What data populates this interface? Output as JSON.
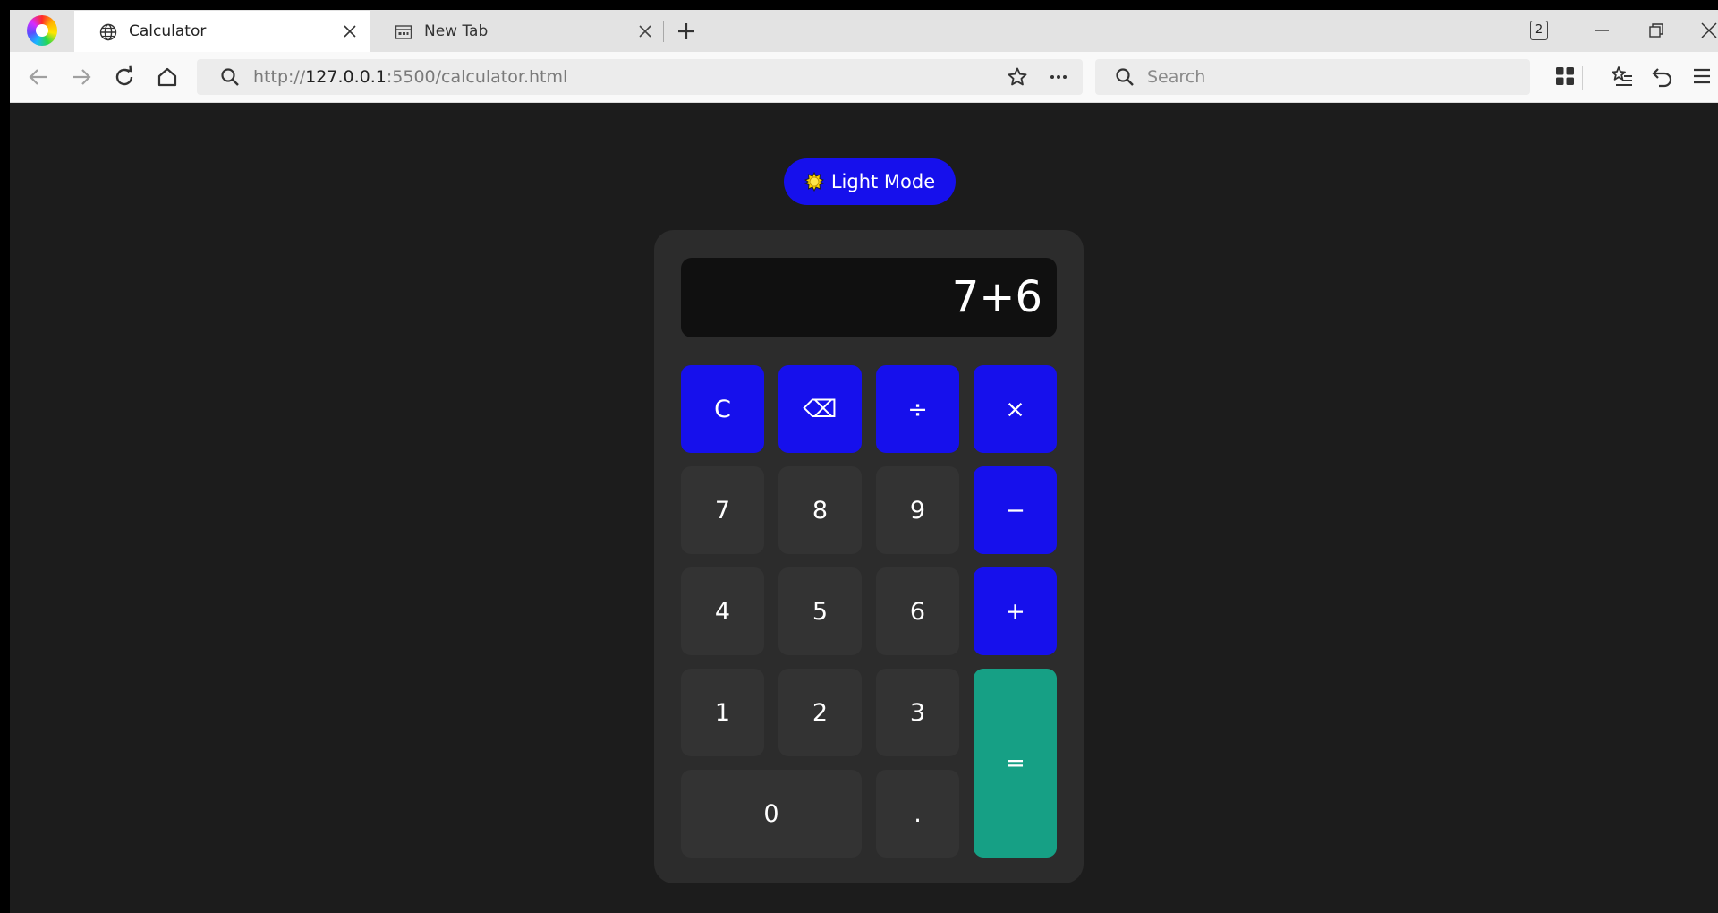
{
  "browser": {
    "tabs": [
      {
        "title": "Calculator",
        "icon": "globe-icon",
        "active": true
      },
      {
        "title": "New Tab",
        "icon": "newtab-page-icon",
        "active": false
      }
    ],
    "tab_count": "2",
    "url": {
      "protocol": "http://",
      "host": "127.0.0.1",
      "rest": ":5500/calculator.html"
    },
    "search_placeholder": "Search"
  },
  "page": {
    "theme_toggle": {
      "icon": "sun-icon",
      "label": "Light Mode"
    },
    "display": "7+6",
    "keys": {
      "clear": "C",
      "backspace": "⌫",
      "divide": "÷",
      "multiply": "×",
      "seven": "7",
      "eight": "8",
      "nine": "9",
      "subtract": "−",
      "four": "4",
      "five": "5",
      "six": "6",
      "add": "+",
      "one": "1",
      "two": "2",
      "three": "3",
      "equals": "=",
      "zero": "0",
      "decimal": "."
    },
    "colors": {
      "background": "#1c1c1c",
      "calculator_body": "#2c2c2c",
      "display_bg": "#101010",
      "number_key": "#333333",
      "operator_key": "#1610ec",
      "equals_key": "#16a085"
    }
  }
}
